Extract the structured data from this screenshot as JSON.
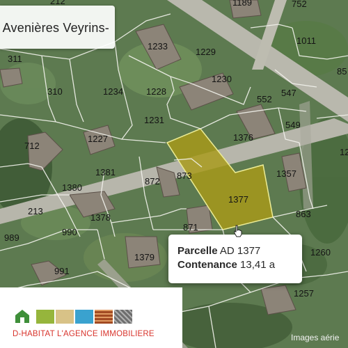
{
  "place_name": "Avenières Veyrins-",
  "parcels": {
    "p212": "212",
    "p1189": "1189",
    "p752": "752",
    "p1233": "1233",
    "p1229": "1229",
    "p1011": "1011",
    "p311": "311",
    "p85": "85",
    "p310": "310",
    "p1234": "1234",
    "p1228": "1228",
    "p1230": "1230",
    "p552": "552",
    "p547": "547",
    "p712": "712",
    "p1231": "1231",
    "p1227": "1227",
    "p1376": "1376",
    "p549": "549",
    "p12": "12",
    "p1357": "1357",
    "p1381": "1381",
    "p873": "873",
    "p872": "872",
    "p1380": "1380",
    "p1377": "1377",
    "p213": "213",
    "p1378": "1378",
    "p863": "863",
    "p871": "871",
    "p990": "990",
    "p989": "989",
    "p1260": "1260",
    "p1379": "1379",
    "p991": "991",
    "p1257": "1257",
    "p1": "1"
  },
  "popup": {
    "parcelle_label": "Parcelle",
    "parcelle_value": "AD 1377",
    "contenance_label": "Contenance",
    "contenance_value": "13,41 a"
  },
  "logo": {
    "text": "D-HABITAT L'AGENCE IMMOBILIERE",
    "colors": [
      "#3f8f3a",
      "#96b53c",
      "#d8c287",
      "#3aa2cf",
      "#a24a22",
      "#6e6e6e"
    ]
  },
  "footer": "Images aérie",
  "highlight_color": "#a89a18"
}
